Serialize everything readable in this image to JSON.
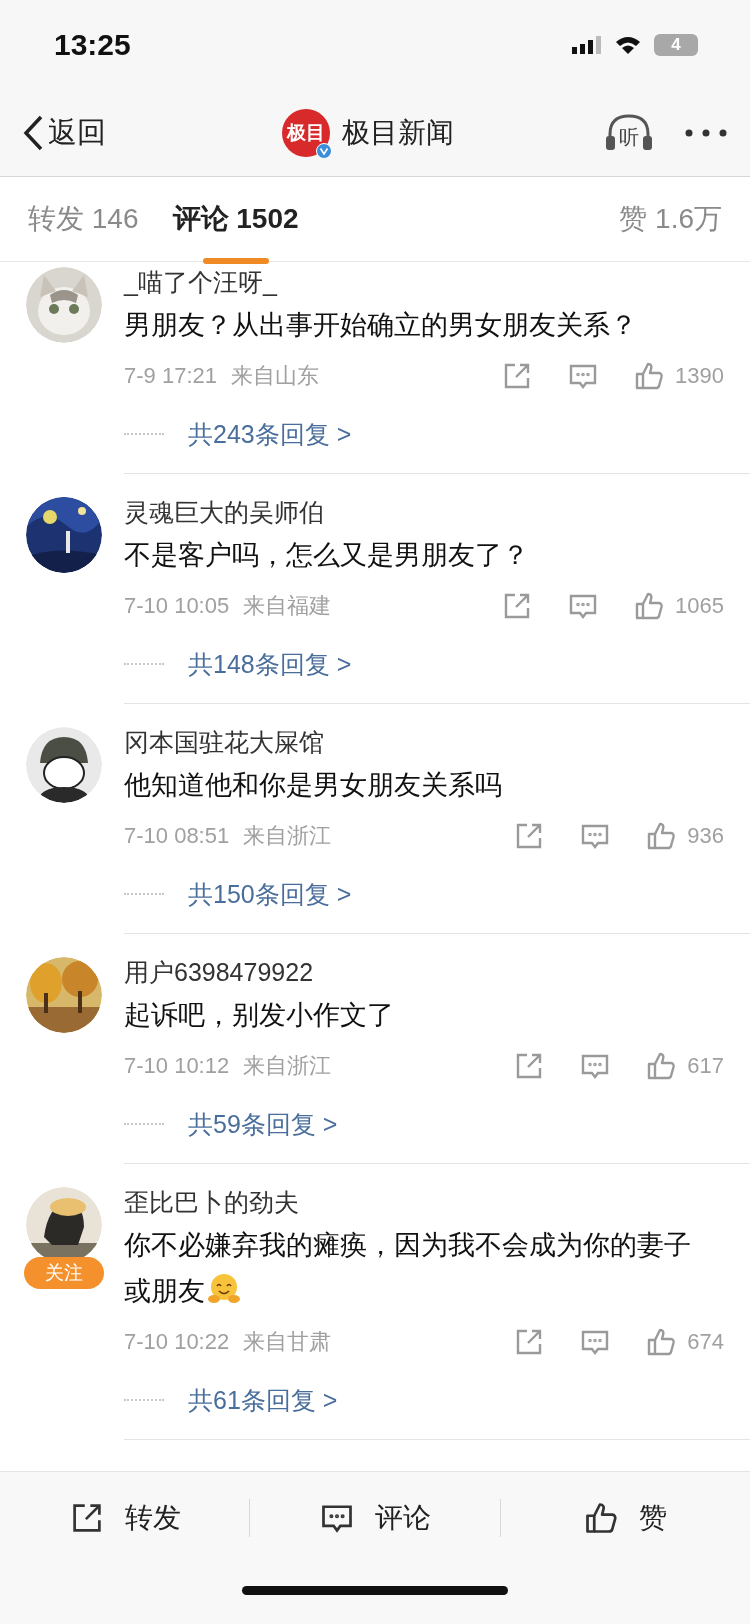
{
  "status_bar": {
    "time": "13:25",
    "battery": "4"
  },
  "nav": {
    "back": "返回",
    "logo_text": "极目",
    "verified": true,
    "title": "极目新闻",
    "listen": "听"
  },
  "tabs": [
    {
      "label": "转发",
      "count": "146",
      "selected": false
    },
    {
      "label": "评论",
      "count": "1502",
      "selected": true
    },
    {
      "label": "赞",
      "count": "1.6万",
      "selected": false
    }
  ],
  "comments": [
    {
      "name": "_喵了个汪呀_",
      "text": "男朋友？从出事开始确立的男女朋友关系？",
      "time": "7-9 17:21",
      "source": "来自山东",
      "likes": "1390",
      "replies": "共243条回复 >",
      "has_emoji": false
    },
    {
      "name": "灵魂巨大的吴师伯",
      "text": "不是客户吗，怎么又是男朋友了？",
      "time": "7-10 10:05",
      "source": "来自福建",
      "likes": "1065",
      "replies": "共148条回复 >",
      "has_emoji": false
    },
    {
      "name": "冈本国驻花大屎馆",
      "text": "他知道他和你是男女朋友关系吗",
      "time": "7-10 08:51",
      "source": "来自浙江",
      "likes": "936",
      "replies": "共150条回复 >",
      "has_emoji": false
    },
    {
      "name": "用户6398479922",
      "text": "起诉吧，别发小作文了",
      "time": "7-10 10:12",
      "source": "来自浙江",
      "likes": "617",
      "replies": "共59条回复 >",
      "has_emoji": false
    },
    {
      "name": "歪比巴卜的劲夫",
      "follow_badge": "关注",
      "text": "你不必嫌弃我的瘫痪，因为我不会成为你的妻子或朋友",
      "time": "7-10 10:22",
      "source": "来自甘肃",
      "likes": "674",
      "replies": "共61条回复 >",
      "has_emoji": true
    }
  ],
  "bottom_bar": [
    {
      "kind": "share",
      "label": "转发"
    },
    {
      "kind": "comment",
      "label": "评论"
    },
    {
      "kind": "like",
      "label": "赞"
    }
  ]
}
